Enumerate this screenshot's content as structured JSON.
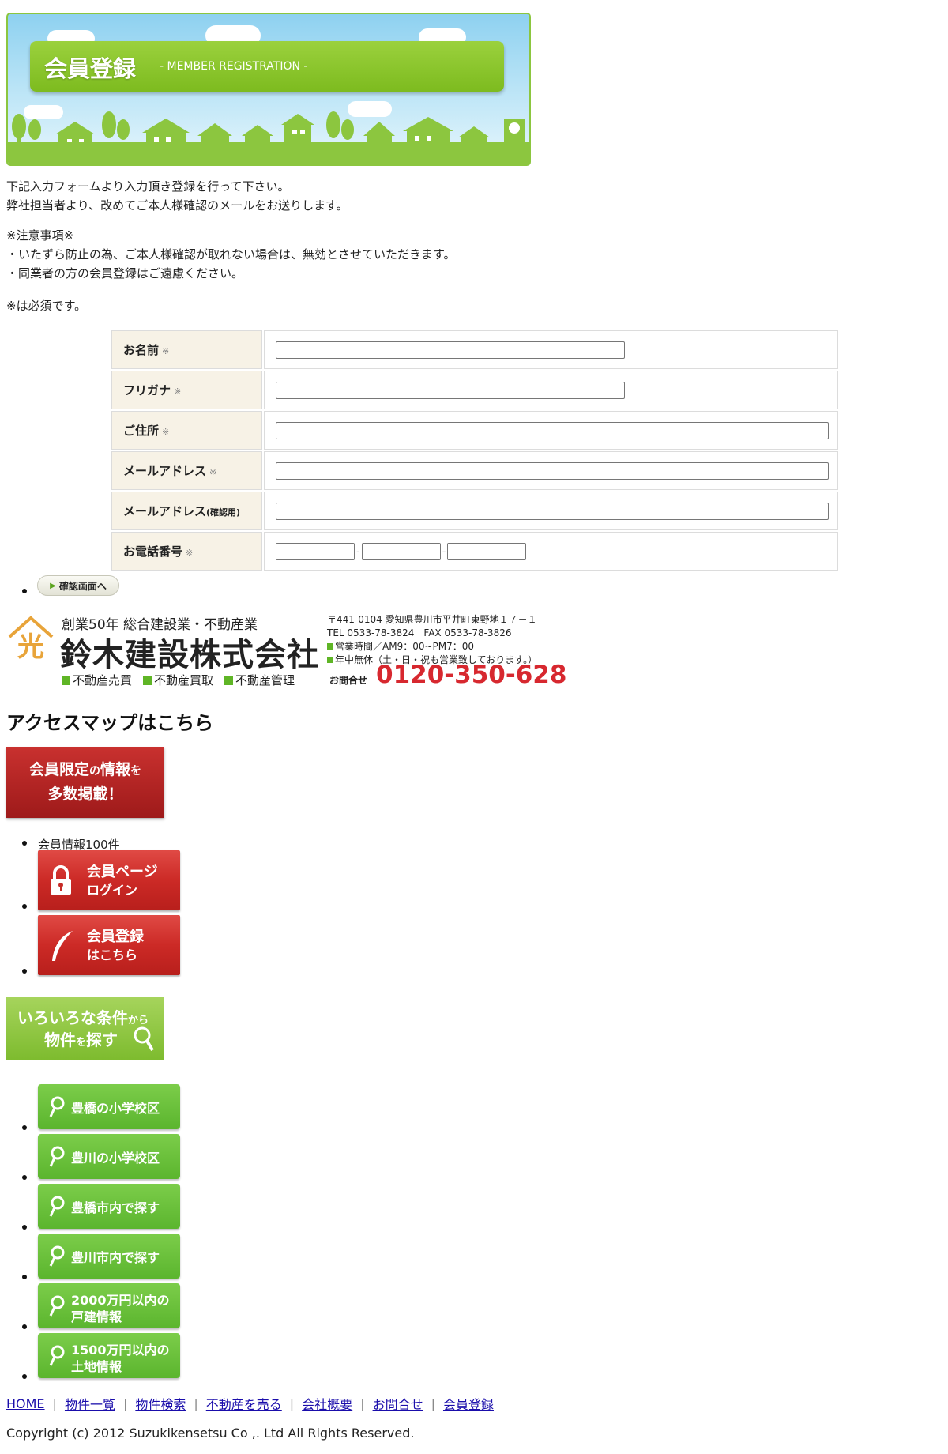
{
  "banner": {
    "title": "会員登録",
    "subtitle": "- MEMBER REGISTRATION -"
  },
  "intro": {
    "line1": "下記入力フォームより入力頂き登録を行って下さい。",
    "line2": "弊社担当者より、改めてご本人様確認のメールをお送りします。"
  },
  "notes": {
    "heading": "※注意事項※",
    "item1": "・いたずら防止の為、ご本人様確認が取れない場合は、無効とさせていただきます。",
    "item2": "・同業者の方の会員登録はご遠慮ください。"
  },
  "required_note": "※は必須です。",
  "form": {
    "required_mark": "※",
    "name_label": "お名前",
    "kana_label": "フリガナ",
    "address_label": "ご住所",
    "email_label": "メールアドレス",
    "email_confirm_label": "メールアドレス",
    "email_confirm_suffix": "(確認用)",
    "phone_label": "お電話番号",
    "phone_dash": "-",
    "name_value": "",
    "kana_value": "",
    "address_value": "",
    "email_value": "",
    "email_confirm_value": "",
    "phone1_value": "",
    "phone2_value": "",
    "phone3_value": ""
  },
  "confirm_button": "確認画面へ",
  "company": {
    "tagline": "創業50年 総合建設業・不動産業",
    "name": "鈴木建設株式会社",
    "services": [
      "不動産売買",
      "不動産買取",
      "不動産管理"
    ],
    "address": "〒441-0104 愛知県豊川市平井町東野地１７－１",
    "tel_fax": "TEL 0533-78-3824　FAX 0533-78-3826",
    "hours": "営業時間／AM9：00~PM7：00",
    "holidays": "年中無休（土・日・祝も営業致しております。）",
    "contact_label": "お問合せ",
    "freedial": "0120-350-628"
  },
  "access_heading": "アクセスマップはこちら",
  "promo": {
    "line1_a": "会員限定",
    "line1_b": "の",
    "line1_c": "情報",
    "line1_d": "を",
    "line2": "多数掲載！"
  },
  "member_count": "会員情報100件",
  "red_buttons": [
    {
      "line1": "会員ページ",
      "line2": "ログイン"
    },
    {
      "line1": "会員登録",
      "line2": "はこちら"
    }
  ],
  "search_promo": {
    "a1": "いろいろな条件",
    "a2": "から",
    "b1": "物件",
    "b2": "を",
    "b3": "探す"
  },
  "search_buttons": [
    {
      "line1": "豊橋の小学校区",
      "line2": ""
    },
    {
      "line1": "豊川の小学校区",
      "line2": ""
    },
    {
      "line1": "豊橋市内で探す",
      "line2": ""
    },
    {
      "line1": "豊川市内で探す",
      "line2": ""
    },
    {
      "line1": "2000万円以内の",
      "line2": "戸建情報"
    },
    {
      "line1": "1500万円以内の",
      "line2": "土地情報"
    }
  ],
  "footer": {
    "links": [
      "HOME",
      "物件一覧",
      "物件検索",
      "不動産を売る",
      "会社概要",
      "お問合せ",
      "会員登録"
    ],
    "separator": "|",
    "copyright": "Copyright (c) 2012 Suzukikensetsu Co ,. Ltd All Rights Reserved."
  }
}
